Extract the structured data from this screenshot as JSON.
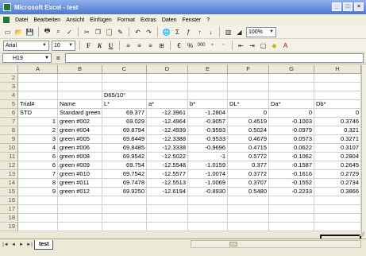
{
  "window": {
    "title": "Microsoft Excel - test",
    "controls": [
      "_",
      "□",
      "×"
    ]
  },
  "menubar": {
    "items": [
      "Datei",
      "Bearbeiten",
      "Ansicht",
      "Einfügen",
      "Format",
      "Extras",
      "Daten",
      "Fenster",
      "?"
    ]
  },
  "toolbar1": {
    "buttons": [
      "new-icon",
      "open-icon",
      "save-icon",
      "print-icon",
      "print-preview-icon",
      "spelling-icon",
      "cut-icon",
      "copy-icon",
      "paste-icon",
      "format-painter-icon",
      "undo-icon",
      "redo-icon",
      "hyperlink-icon",
      "autosum-icon",
      "function-icon",
      "sort-asc-icon",
      "sort-desc-icon",
      "chart-wizard-icon",
      "drawing-icon"
    ],
    "zoom": "100%"
  },
  "toolbar2": {
    "font": "Arial",
    "size": "10",
    "bold": "F",
    "italic": "K",
    "underline": "U",
    "currency": "%",
    "thousands": "000"
  },
  "formula": {
    "namebox": "H19",
    "eq": "=",
    "value": ""
  },
  "columns": [
    "A",
    "B",
    "C",
    "D",
    "E",
    "F",
    "G",
    "H"
  ],
  "rows": [
    {
      "n": "2",
      "cells": [
        "",
        "",
        "",
        "",
        "",
        "",
        "",
        ""
      ]
    },
    {
      "n": "3",
      "cells": [
        "",
        "",
        "",
        "",
        "",
        "",
        "",
        ""
      ]
    },
    {
      "n": "4",
      "cells": [
        "",
        "",
        "D65/10°",
        "",
        "",
        "",
        "",
        ""
      ]
    },
    {
      "n": "5",
      "cells": [
        "Trial#",
        "Name",
        "L*",
        "a*",
        "b*",
        "DL*",
        "Da*",
        "Db*"
      ]
    },
    {
      "n": "6",
      "cells": [
        "STD",
        "Standard green",
        "69.377",
        "-12.3961",
        "-1.2804",
        "0",
        "0",
        "0"
      ]
    },
    {
      "n": "7",
      "cells": [
        "1",
        "green #002",
        "69.029",
        "-12.4964",
        "-0.9057",
        "0.4519",
        "-0.1003",
        "0.3746"
      ]
    },
    {
      "n": "8",
      "cells": [
        "2",
        "green #004",
        "69.8794",
        "-12.4939",
        "-0.9593",
        "0.5024",
        "-0.0979",
        "0.321"
      ]
    },
    {
      "n": "9",
      "cells": [
        "3",
        "green #005",
        "69.8449",
        "-12.3388",
        "-0.9533",
        "0.4679",
        "0.0573",
        "0.3271"
      ]
    },
    {
      "n": "10",
      "cells": [
        "4",
        "green #006",
        "69.8485",
        "-12.3338",
        "-0.9696",
        "0.4715",
        "0.0622",
        "0.3107"
      ]
    },
    {
      "n": "11",
      "cells": [
        "6",
        "green #008",
        "69.9542",
        "-12.5022",
        "-1",
        "0.5772",
        "-0.1062",
        "0.2804"
      ]
    },
    {
      "n": "12",
      "cells": [
        "6",
        "green #009",
        "69.754",
        "-12.5548",
        "-1.0159",
        "0.377",
        "-0.1587",
        "0.2645"
      ]
    },
    {
      "n": "13",
      "cells": [
        "7",
        "green #010",
        "69.7542",
        "-12.5577",
        "-1.0074",
        "0.3772",
        "-0.1616",
        "0.2729"
      ]
    },
    {
      "n": "14",
      "cells": [
        "8",
        "green #011",
        "69.7478",
        "-12.5513",
        "-1.0069",
        "0.3707",
        "-0.1552",
        "0.2734"
      ]
    },
    {
      "n": "15",
      "cells": [
        "9",
        "green #012",
        "69.9250",
        "-12.6194",
        "-0.8930",
        "0.5480",
        "-0.2233",
        "0.3866"
      ]
    },
    {
      "n": "16",
      "cells": [
        "",
        "",
        "",
        "",
        "",
        "",
        "",
        ""
      ]
    },
    {
      "n": "17",
      "cells": [
        "",
        "",
        "",
        "",
        "",
        "",
        "",
        ""
      ]
    },
    {
      "n": "18",
      "cells": [
        "",
        "",
        "",
        "",
        "",
        "",
        "",
        ""
      ]
    },
    {
      "n": "19",
      "cells": [
        "",
        "",
        "",
        "",
        "",
        "",
        "",
        ""
      ]
    }
  ],
  "sheet": {
    "tab": "test",
    "nav": [
      "|◄",
      "◄",
      "►",
      "►|"
    ]
  }
}
